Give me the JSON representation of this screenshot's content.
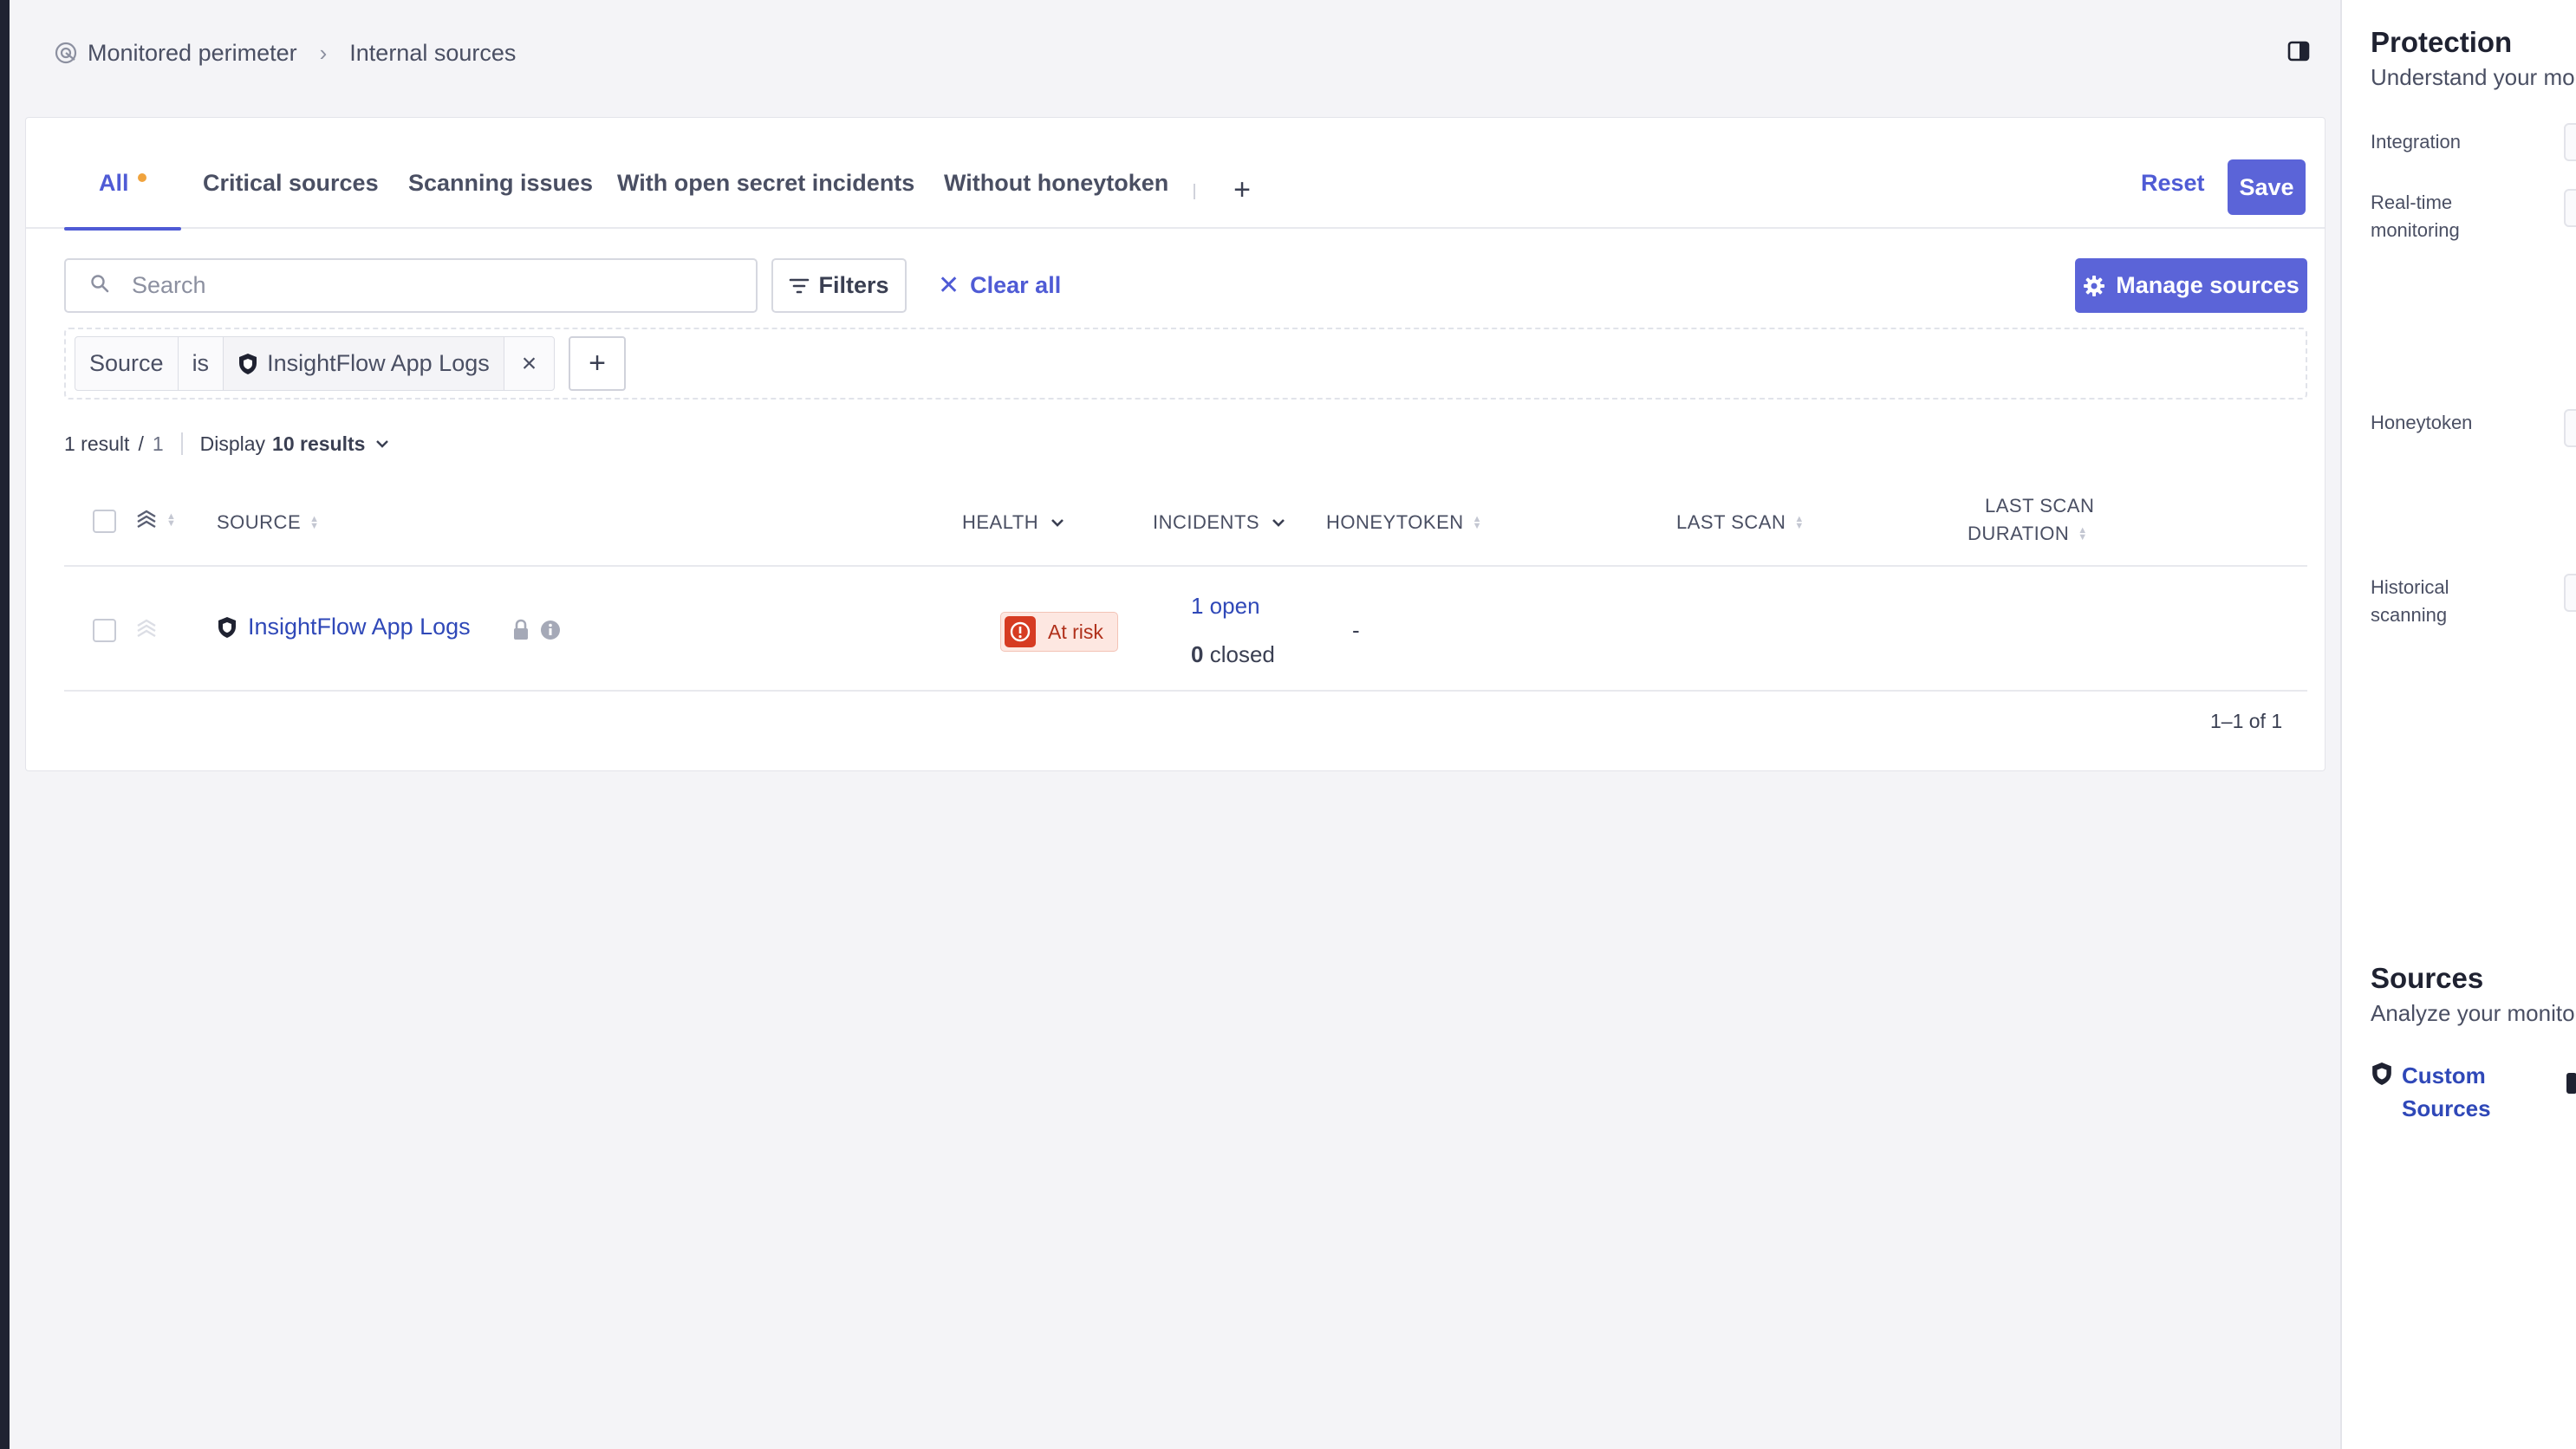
{
  "breadcrumb": {
    "root": "Monitored perimeter",
    "separator": "›",
    "current": "Internal sources"
  },
  "tabs": [
    {
      "label": "All",
      "active": true,
      "has_indicator": true
    },
    {
      "label": "Critical sources"
    },
    {
      "label": "Scanning issues"
    },
    {
      "label": "With open secret incidents"
    },
    {
      "label": "Without honeytoken"
    }
  ],
  "toolbar": {
    "add_tab": "+",
    "reset_label": "Reset",
    "save_label": "Save",
    "search_placeholder": "Search",
    "filters_label": "Filters",
    "clear_all_label": "Clear all",
    "manage_sources_label": "Manage sources"
  },
  "filter_chip": {
    "field": "Source",
    "operator": "is",
    "value": "InsightFlow App Logs",
    "remove": "×",
    "add": "+"
  },
  "results": {
    "count_text": "1 result",
    "slash": "/",
    "total": "1",
    "display_label": "Display",
    "display_value": "10 results"
  },
  "table": {
    "columns": {
      "source": "SOURCE",
      "health": "HEALTH",
      "incidents": "INCIDENTS",
      "honeytoken": "HONEYTOKEN",
      "last_scan": "LAST SCAN",
      "last_scan_duration_1": "LAST SCAN",
      "last_scan_duration_2": "DURATION"
    },
    "rows": [
      {
        "source": "InsightFlow App Logs",
        "health": "At risk",
        "incidents_open": "1 open",
        "incidents_closed_count": "0",
        "incidents_closed_label": "closed",
        "honeytoken": "-"
      }
    ],
    "pagination": "1–1 of 1"
  },
  "side_panel": {
    "protection_title": "Protection",
    "protection_subtitle": "Understand your mo",
    "integration_label": "Integration",
    "realtime_label": "Real-time monitoring",
    "honeytoken_label": "Honeytoken",
    "historical_label": "Historical scanning",
    "sources_title": "Sources",
    "sources_subtitle": "Analyze your monito",
    "custom_sources_label": "Custom Sources"
  },
  "colors": {
    "accent": "#4f5bd5",
    "primary_button": "#5b64d8",
    "link": "#2f48b8",
    "risk_bg": "#fde7e1",
    "risk_icon": "#d63b22",
    "tab_indicator": "#f0a33d",
    "rail": "#1f2231"
  }
}
